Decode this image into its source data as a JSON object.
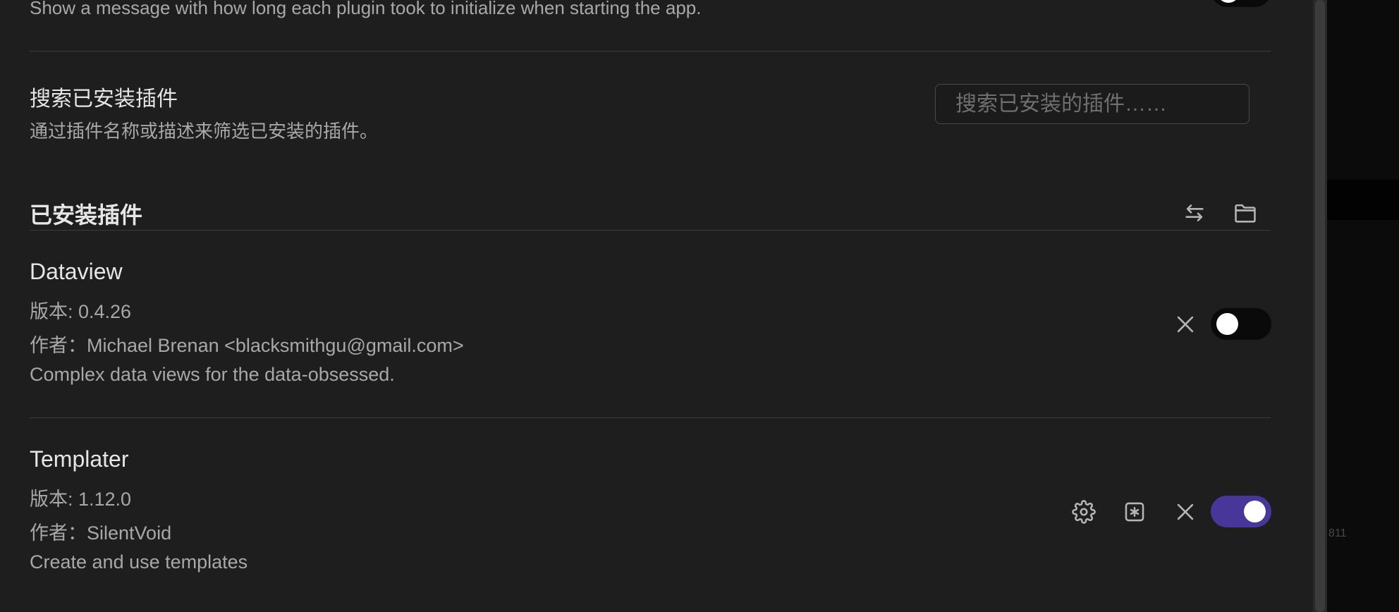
{
  "top_setting": {
    "description": "Show a message with how long each plugin took to initialize when starting the app."
  },
  "search_setting": {
    "name": "搜索已安装插件",
    "description": "通过插件名称或描述来筛选已安装的插件。",
    "input_placeholder": "搜索已安装的插件……",
    "input_value": ""
  },
  "installed_section": {
    "title": "已安装插件",
    "icons": [
      "reload-icon",
      "folder-icon"
    ]
  },
  "plugins": [
    {
      "name": "Dataview",
      "version": "版本: 0.4.26",
      "author": "作者：Michael Brenan <blacksmithgu@gmail.com>",
      "description": "Complex data views for the data-obsessed.",
      "enabled": false
    },
    {
      "name": "Templater",
      "version": "版本: 1.12.0",
      "author": "作者：SilentVoid",
      "description": "Create and use templates",
      "enabled": true
    }
  ],
  "background": {
    "partial_number": "811"
  },
  "colors": {
    "panel_bg": "#1e1e1e",
    "accent": "#483699",
    "text_primary": "#e6e6e6",
    "text_muted": "#a8a8a8",
    "divider": "#3a3a3a"
  }
}
